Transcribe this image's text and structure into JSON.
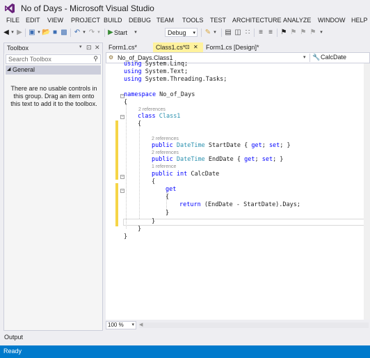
{
  "window": {
    "title": "No of Days - Microsoft Visual Studio"
  },
  "menu": {
    "items": [
      "FILE",
      "EDIT",
      "VIEW",
      "PROJECT",
      "BUILD",
      "DEBUG",
      "TEAM",
      "TOOLS",
      "TEST",
      "ARCHITECTURE",
      "ANALYZE",
      "WINDOW",
      "HELP"
    ]
  },
  "toolbar": {
    "start_label": "Start",
    "config_value": "Debug"
  },
  "toolbox": {
    "title": "Toolbox",
    "search_placeholder": "Search Toolbox",
    "group_label": "General",
    "empty_message": "There are no usable controls in this group. Drag an item onto this text to add it to the toolbox."
  },
  "tabs": [
    {
      "label": "Form1.cs*"
    },
    {
      "label": "Class1.cs*"
    },
    {
      "label": "Form1.cs [Design]*"
    }
  ],
  "navbar": {
    "type_value": "No_of_Days.Class1",
    "member_value": "CalcDate"
  },
  "code": {
    "lines": [
      "using System.Linq;",
      "using System.Text;",
      "using System.Threading.Tasks;",
      "",
      "namespace No_of_Days",
      "{",
      "class Class1",
      "{",
      "public DateTime StartDate { get; set; }",
      "public DateTime EndDate { get; set; }",
      "public int CalcDate",
      "{",
      "get",
      "{",
      "return (EndDate - StartDate).Days;",
      "}",
      "}",
      "}",
      "}"
    ],
    "refs": [
      "2 references",
      "2 references",
      "2 references",
      "1 reference"
    ]
  },
  "zoom": {
    "value": "100 %"
  },
  "output": {
    "label": "Output"
  },
  "status": {
    "text": "Ready",
    "bar_color": "#007ACC"
  },
  "colors": {
    "keyword": "#0000FF",
    "type": "#2B91AF",
    "change_marker": "#F5D547",
    "active_tab": "#FFF29D"
  }
}
